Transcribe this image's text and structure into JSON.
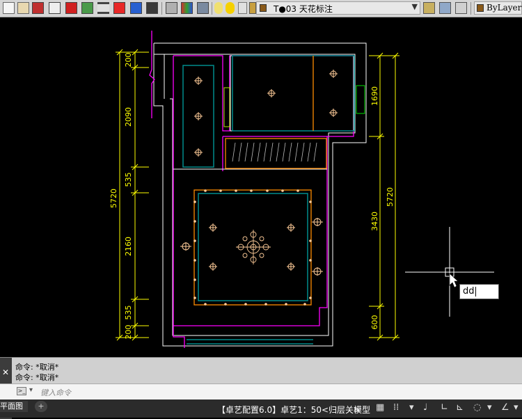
{
  "toolbar": {
    "layer_name": "T●03 天花标注",
    "color_value": "ByLayer",
    "icons": [
      "new-icon",
      "open-icon",
      "save-icon",
      "plot-icon",
      "layer-icon",
      "image-icon",
      "measure-icon",
      "property-icon",
      "match-icon",
      "brush-icon",
      "lisp-icon",
      "palette-icon",
      "layers-stack-icon",
      "bulb-icon",
      "sun-icon",
      "freeze-icon",
      "lock-icon",
      "color-swatch-icon",
      "layer-state-icon",
      "layer-walk-icon"
    ]
  },
  "drawing": {
    "dims_left": [
      "200",
      "2090",
      "535",
      "2160",
      "535",
      "200"
    ],
    "dims_left_total": "5720",
    "dims_right": [
      "1690",
      "3430",
      "600"
    ],
    "dims_right_total": "5720",
    "colors": {
      "wall": "#ffffff",
      "dim": "#ffff00",
      "panel": "#008080",
      "room": "#ff00ff",
      "trim": "#ff8000",
      "light": "#ffcc99"
    }
  },
  "dynamic_input": {
    "value": "dd"
  },
  "command": {
    "history": [
      "命令: *取消*",
      "命令: *取消*"
    ],
    "placeholder": "键入命令"
  },
  "status": {
    "tabs": [
      "平面图"
    ],
    "add_tab": "+",
    "info": "【卓艺配置6.0】卓艺1：50<归层关>",
    "model": "模型"
  }
}
